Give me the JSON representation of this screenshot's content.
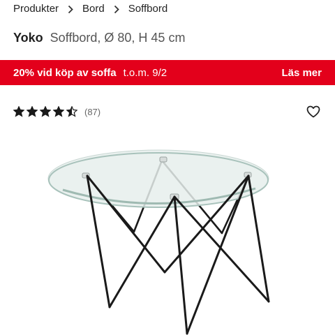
{
  "breadcrumb": {
    "items": [
      "Produkter",
      "Bord",
      "Soffbord"
    ]
  },
  "product": {
    "brand": "Yoko",
    "description": "Soffbord, Ø 80, H 45 cm"
  },
  "promo": {
    "offer": "20% vid köp av soffa",
    "date": "t.o.m. 9/2",
    "link": "Läs mer",
    "color": "#e3001b"
  },
  "rating": {
    "stars": 4.5,
    "max_stars": 5,
    "count_label": "(87)"
  },
  "icons": {
    "breadcrumb_separator": "chevron-right-icon",
    "favorite": "heart-outline-icon",
    "star": "star-icon"
  }
}
